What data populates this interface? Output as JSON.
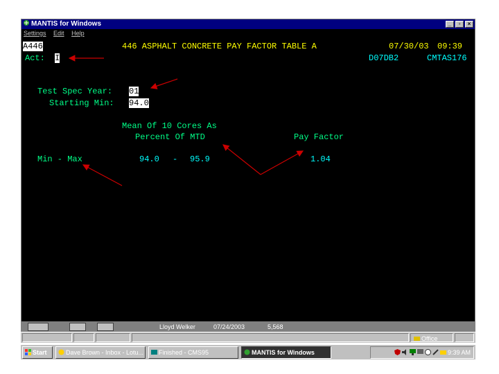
{
  "window": {
    "title": "MANTIS for Windows",
    "menu": [
      "Settings",
      "Edit",
      "Help"
    ]
  },
  "screen": {
    "code": "A446",
    "heading": "446 ASPHALT CONCRETE PAY FACTOR TABLE A",
    "date": "07/30/03",
    "time": "09:39",
    "act_label": "Act:",
    "act_value": "I",
    "term_id": "D07DB2",
    "screen_id": "CMTAS176",
    "spec_year_label": "Test Spec Year:",
    "spec_year_value": "01",
    "starting_min_label": "Starting Min:",
    "starting_min_value": "94.0",
    "col1_header_line1": "Mean Of 10 Cores As",
    "col1_header_line2": "Percent Of MTD",
    "col2_header": "Pay Factor",
    "row_label": "Min - Max",
    "row_min": "94.0",
    "row_dash": "-",
    "row_max": "95.9",
    "row_pay_factor": "1.04"
  },
  "annotations": [
    "(1)",
    "(2)",
    "(3)",
    "(4)"
  ],
  "status_strip": {
    "user": "Lloyd Welker",
    "date": "07/24/2003",
    "number": "5,568",
    "office": "Office"
  },
  "taskbar": {
    "start": "Start",
    "tasks": [
      "Dave Brown - Inbox - Lotu...",
      "Finished - CMS95",
      "MANTIS for Windows"
    ],
    "clock": "9:39 AM"
  },
  "colors": {
    "title_bg": "#000080",
    "heading": "#ffff00",
    "fields": "#00ffff",
    "labels": "#00ff88",
    "annotation_arrows": "#cc0000"
  }
}
